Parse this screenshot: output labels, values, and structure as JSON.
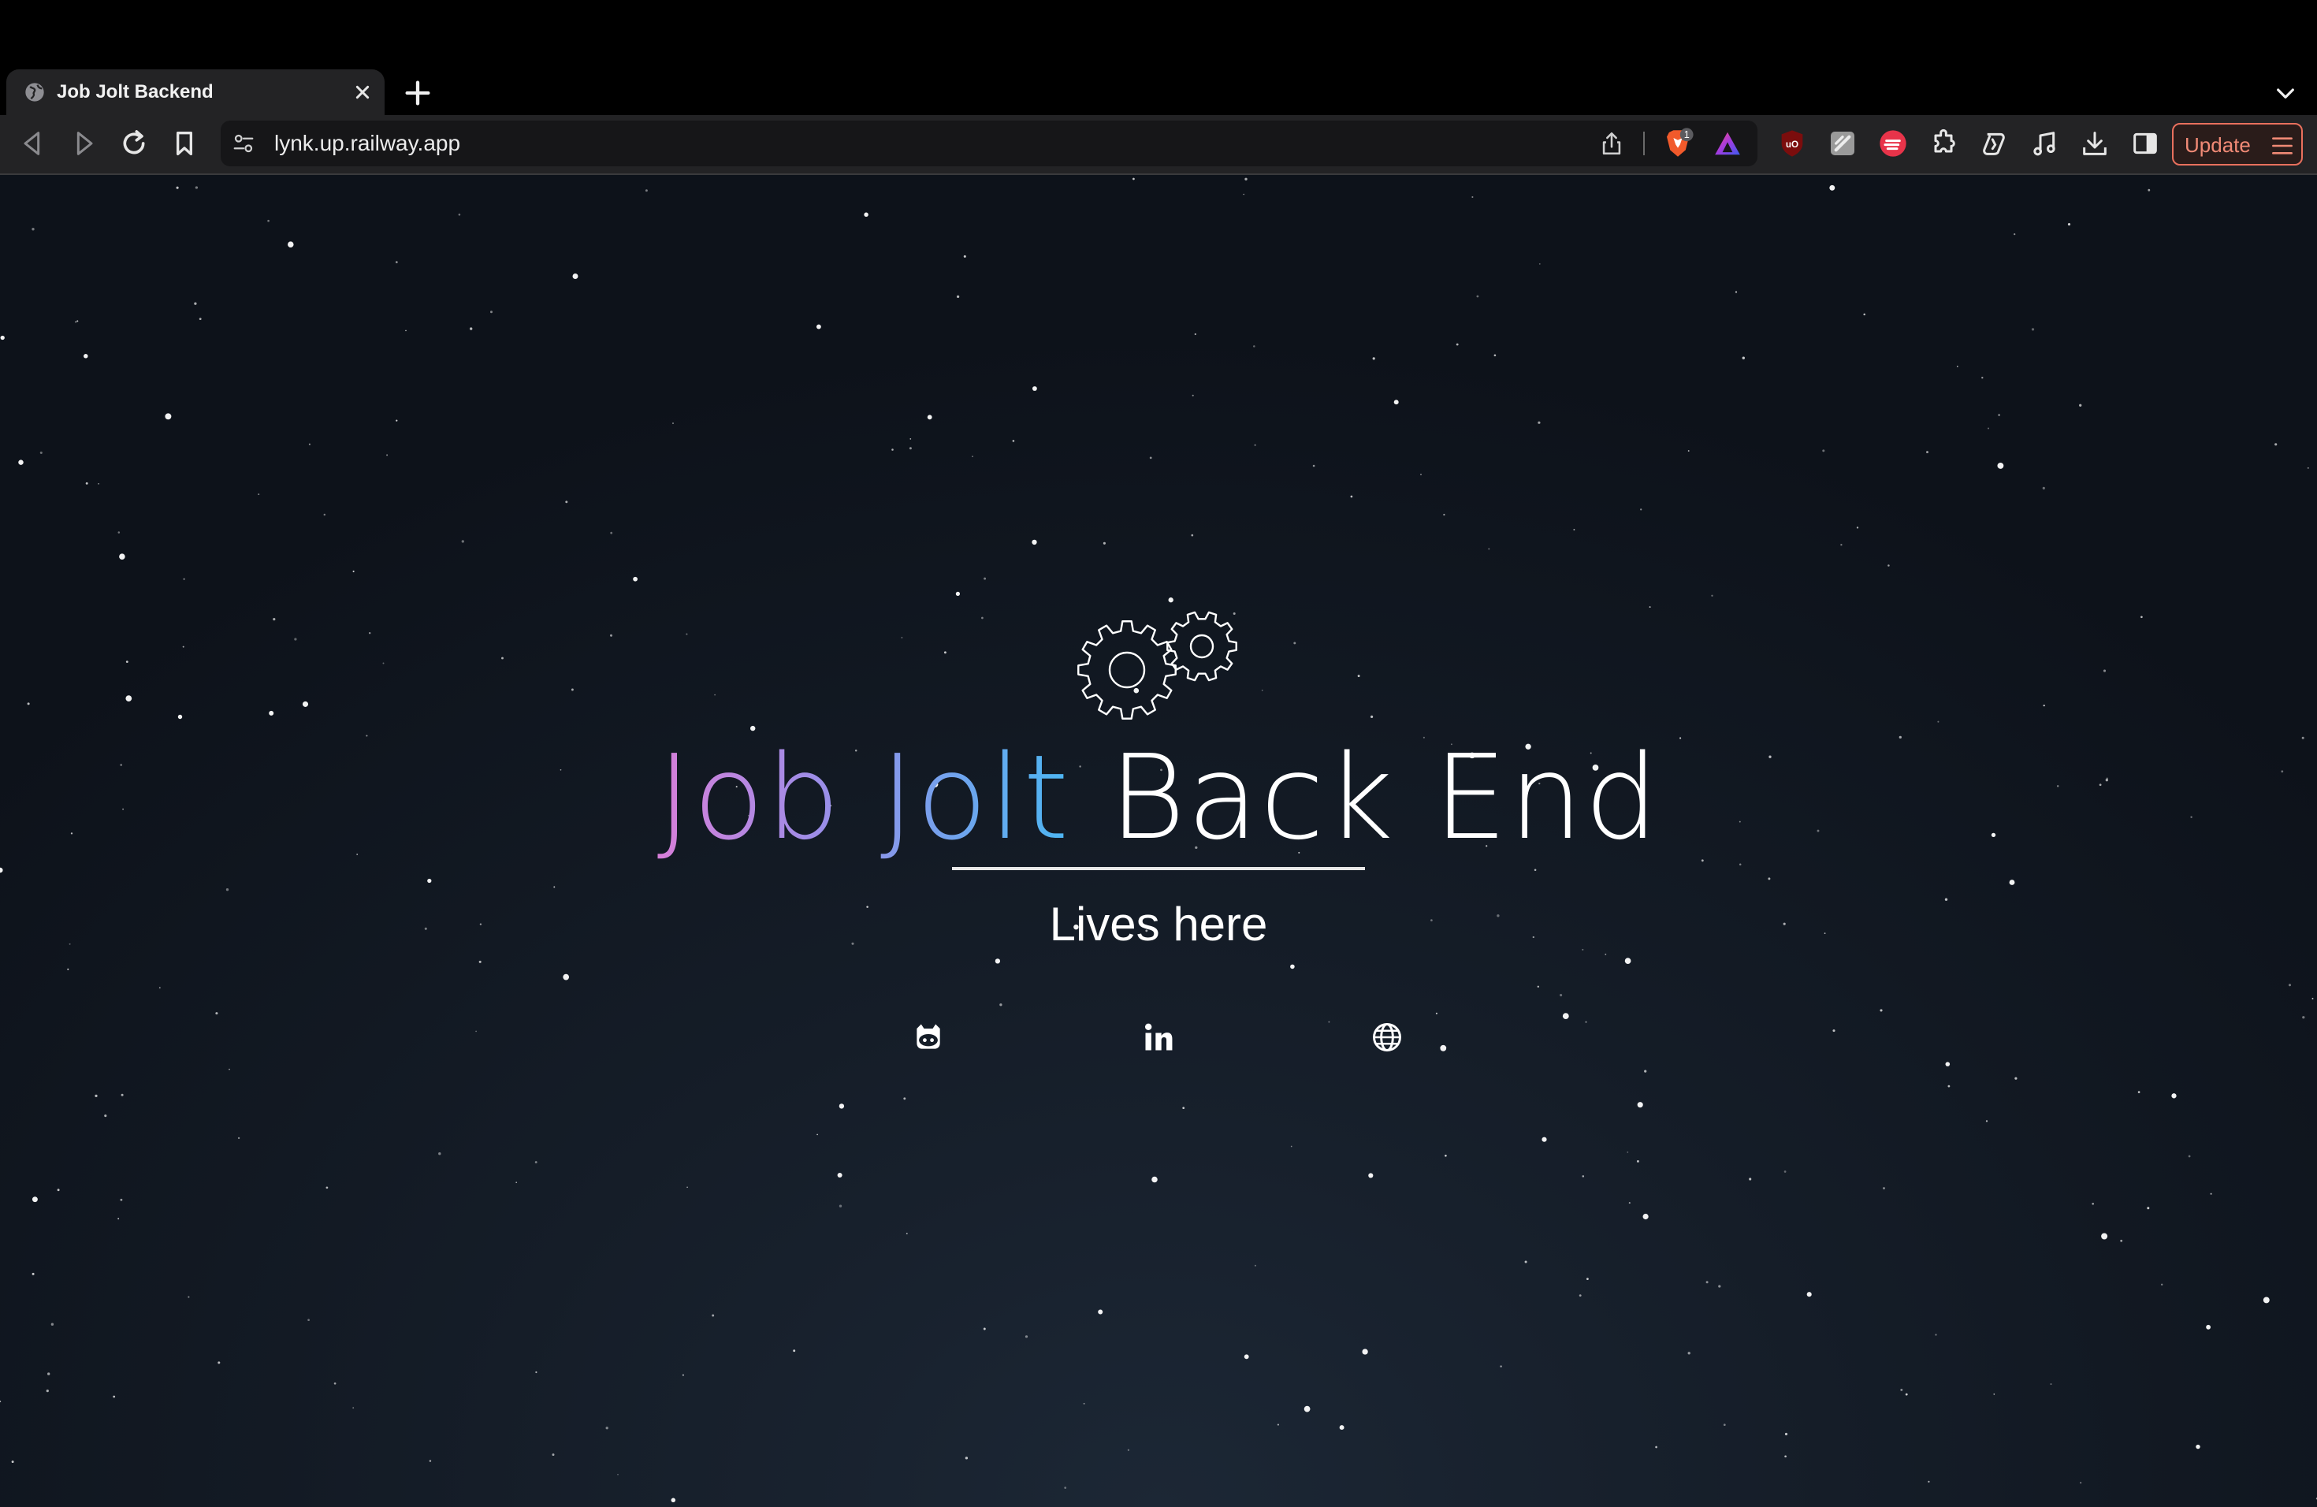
{
  "browser": {
    "tab": {
      "title": "Job Jolt Backend"
    },
    "address": {
      "url": "lynk.up.railway.app"
    },
    "brave_shield_count": "1",
    "update_button_label": "Update"
  },
  "page": {
    "headline": {
      "part1": "Job Jolt",
      "part2": "Back End"
    },
    "tagline": "Lives here",
    "social_links": [
      "github-icon",
      "linkedin-icon",
      "globe-icon"
    ]
  },
  "colors": {
    "headline_gradient": [
      "#d77fd9",
      "#9b8ee8",
      "#4cb6f2"
    ],
    "update_accent": "#e8705d",
    "background": "#151d28"
  }
}
